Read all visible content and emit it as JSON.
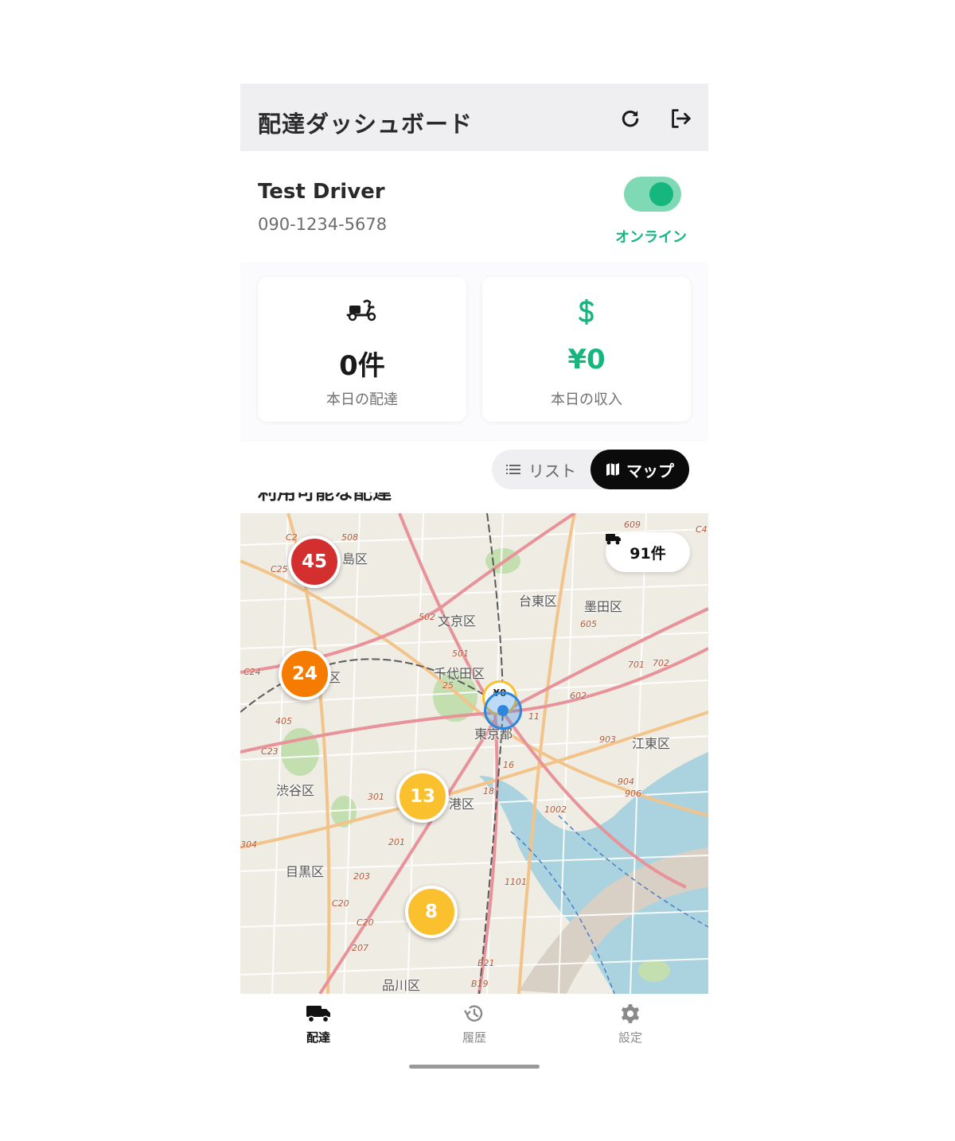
{
  "header": {
    "title": "配達ダッシュボード",
    "refresh_icon": "refresh-icon",
    "logout_icon": "logout-icon"
  },
  "driver": {
    "name": "Test Driver",
    "phone": "090-1234-5678",
    "online": true,
    "status_label": "オンライン"
  },
  "stats": [
    {
      "icon": "scooter-icon",
      "value": "0件",
      "label": "本日の配達",
      "color": "#1a1a1a"
    },
    {
      "icon": "dollar-icon",
      "value": "¥0",
      "label": "本日の収入",
      "color": "#15b77e"
    }
  ],
  "view_toggle": {
    "list_label": "リスト",
    "map_label": "マップ",
    "selected": "map"
  },
  "section_title": "利用可能な配達",
  "map": {
    "count_chip": "91件",
    "clusters": [
      {
        "count": "45",
        "color": "#d32f2f"
      },
      {
        "count": "24",
        "color": "#f57c00"
      },
      {
        "count": "13",
        "color": "#fbc02d"
      },
      {
        "count": "8",
        "color": "#fbc02d"
      }
    ],
    "current_marker_label": "¥0",
    "place_labels": [
      "島区",
      "文京区",
      "台東区",
      "墨田区",
      "千代田区",
      "区",
      "東京都",
      "江東区",
      "渋谷区",
      "港区",
      "目黒区",
      "品川区"
    ],
    "route_numbers": [
      "C2",
      "508",
      "C25",
      "609",
      "C4",
      "502",
      "605",
      "501",
      "701",
      "702",
      "C24",
      "25",
      "602",
      "405",
      "11",
      "903",
      "C23",
      "16",
      "904",
      "906",
      "301",
      "18",
      "1002",
      "304",
      "201",
      "203",
      "1101",
      "C20",
      "C20",
      "207",
      "B21",
      "B19"
    ]
  },
  "bottom_nav": [
    {
      "label": "配達",
      "icon": "truck-icon",
      "active": true
    },
    {
      "label": "履歴",
      "icon": "history-icon",
      "active": false
    },
    {
      "label": "設定",
      "icon": "gear-icon",
      "active": false
    }
  ],
  "colors": {
    "accent": "#15b77e",
    "appbar_bg": "#efeef1",
    "active_segment": "#0b0b0b"
  }
}
